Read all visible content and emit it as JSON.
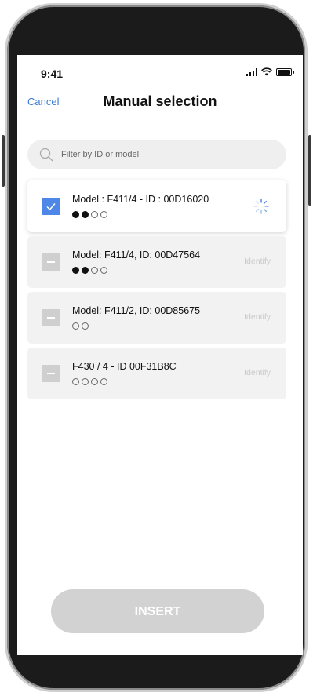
{
  "status": {
    "time": "9:41"
  },
  "header": {
    "cancel_label": "Cancel",
    "title": "Manual selection"
  },
  "search": {
    "placeholder": "Filter by ID or model"
  },
  "devices": [
    {
      "label": "Model : F411/4 - ID : 00D16020",
      "checked": true,
      "dots_filled": 2,
      "dots_total": 4,
      "status": "loading"
    },
    {
      "label": "Model: F411/4, ID: 00D47564",
      "checked": false,
      "dots_filled": 2,
      "dots_total": 4,
      "action_label": "Identify"
    },
    {
      "label": "Model: F411/2, ID: 00D85675",
      "checked": false,
      "dots_filled": 0,
      "dots_total": 2,
      "action_label": "Identify"
    },
    {
      "label": "F430 / 4 - ID 00F31B8C",
      "checked": false,
      "dots_filled": 0,
      "dots_total": 4,
      "action_label": "Identify"
    }
  ],
  "footer": {
    "insert_label": "INSERT"
  },
  "colors": {
    "accent": "#3a7bd5",
    "checkbox_checked": "#4f87e8",
    "button_disabled": "#d2d2d2"
  }
}
